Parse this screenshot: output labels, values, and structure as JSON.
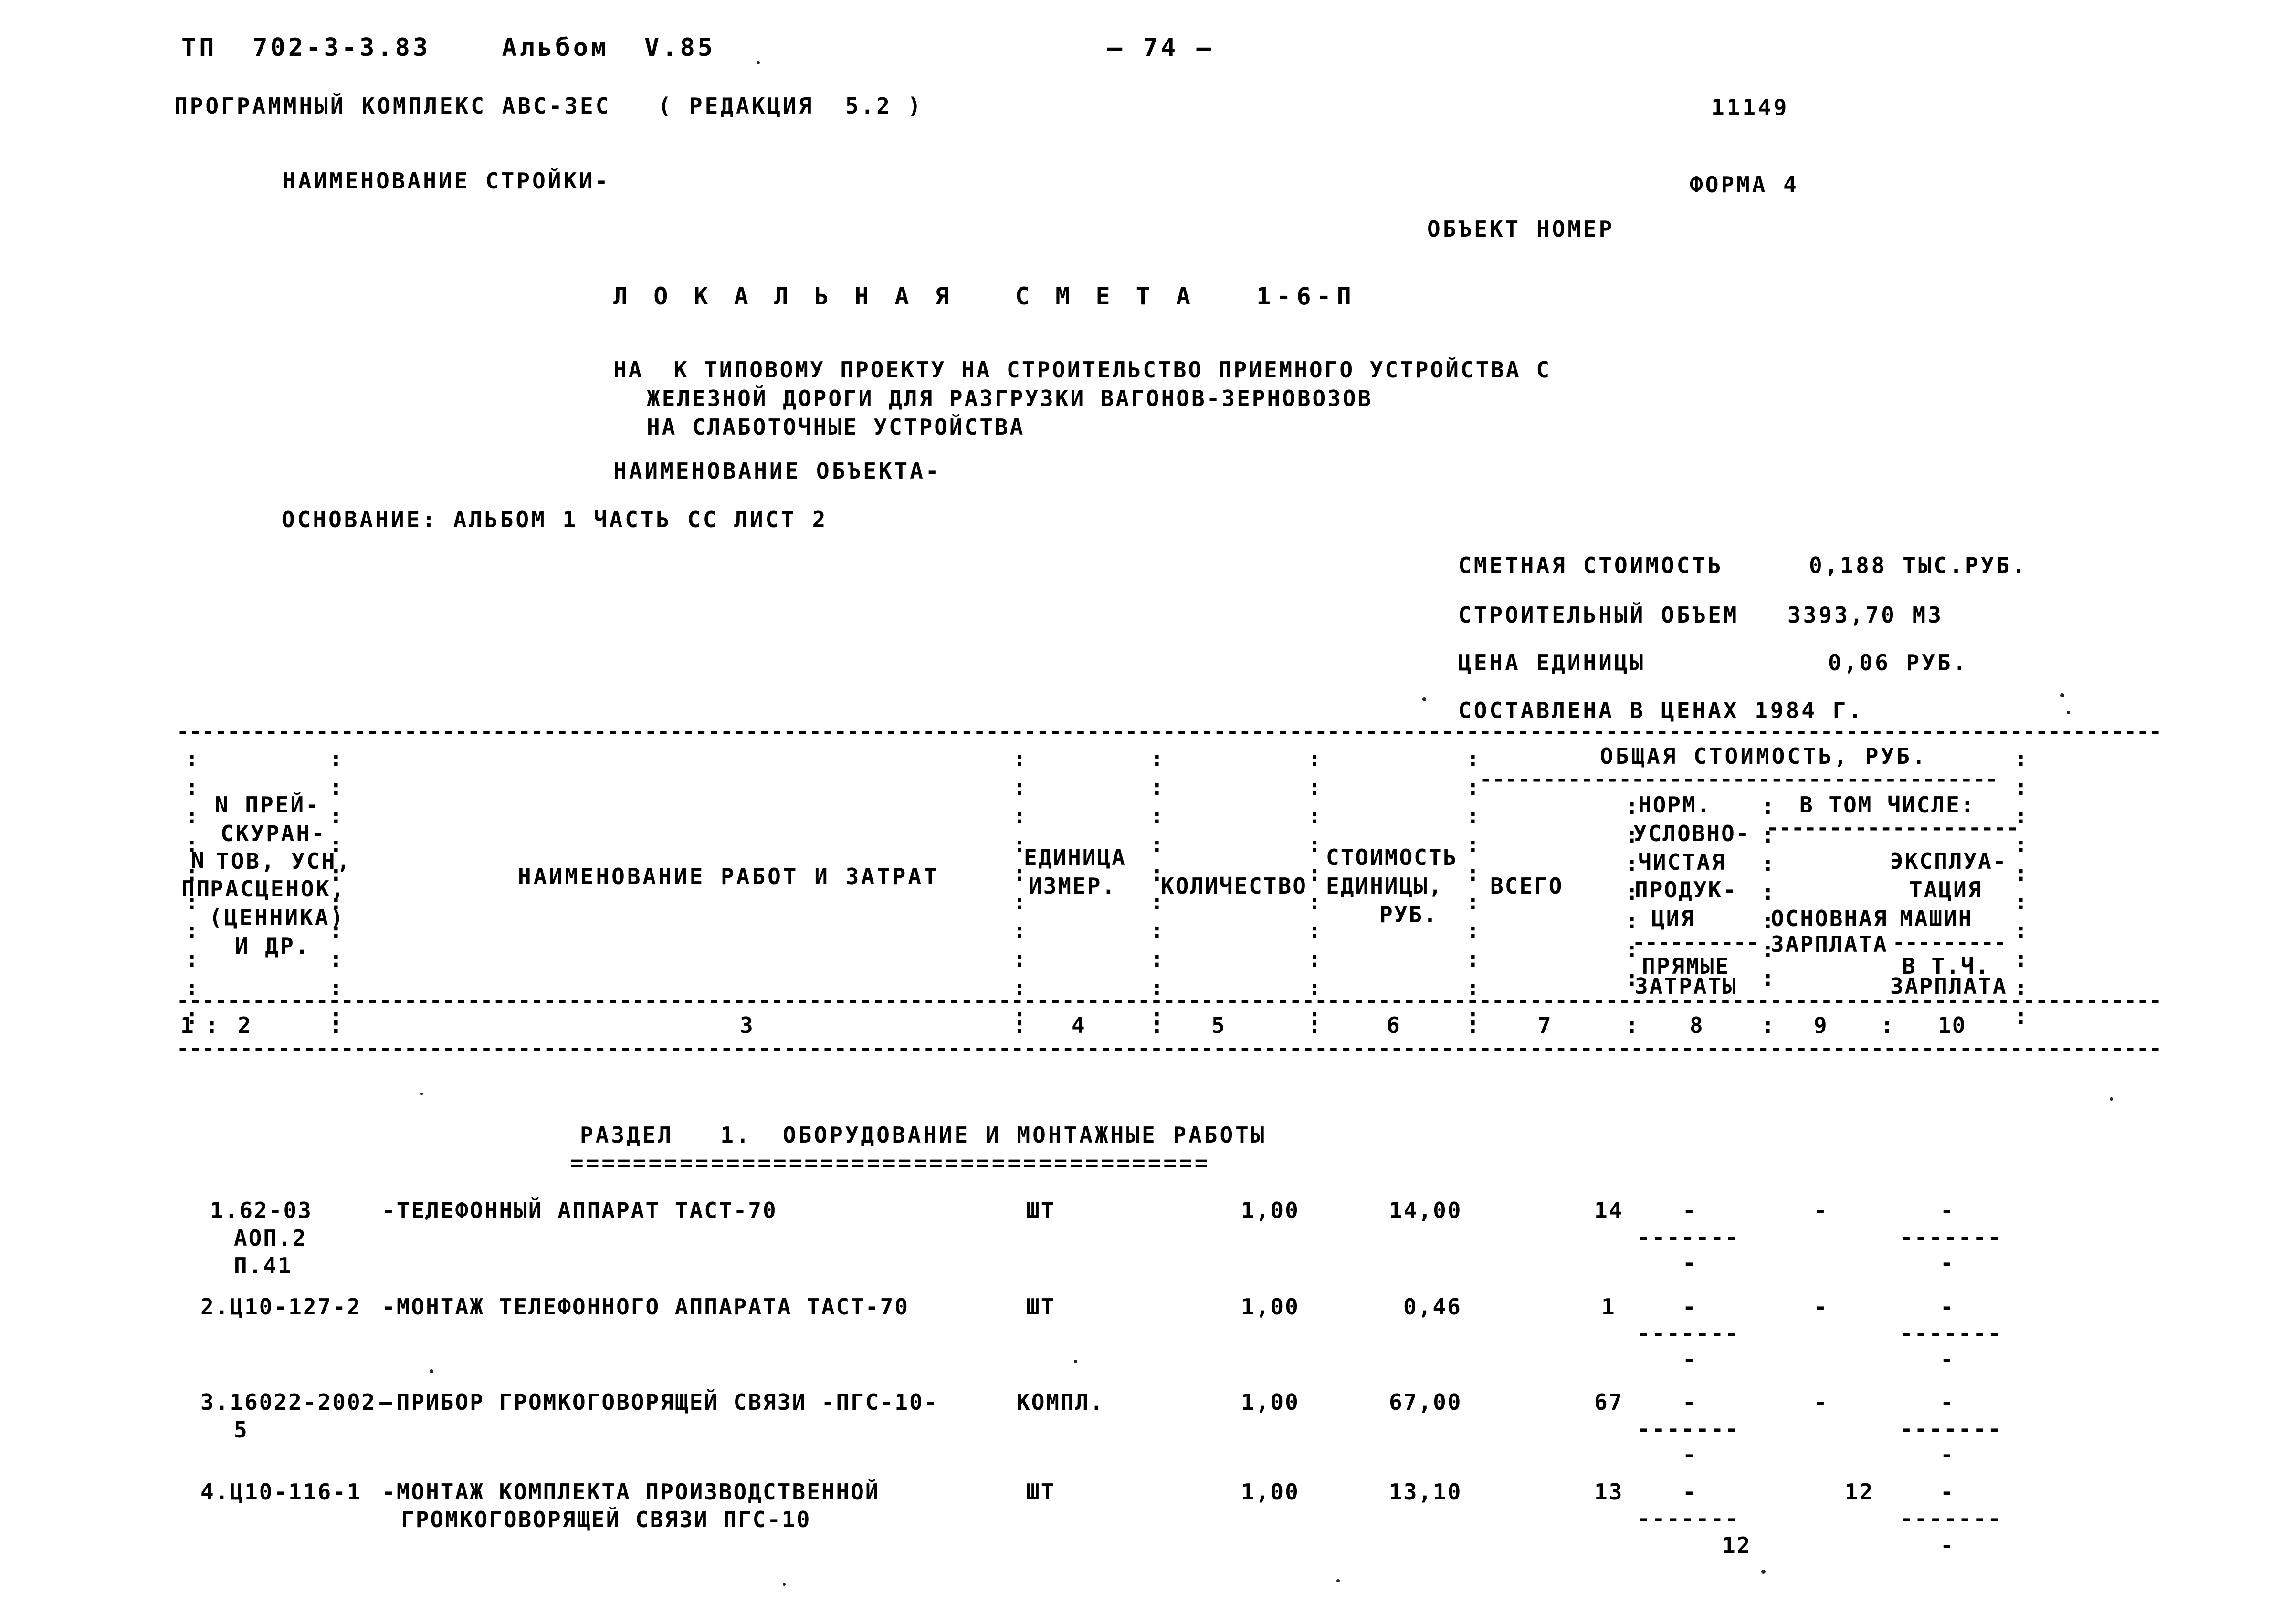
{
  "header": {
    "doc_code": "ТП  702-3-3.83    Альбом  V.85",
    "page_number": "— 74 —",
    "software_line": "ПРОГРАММНЫЙ КОМПЛЕКС АВС-3ЕС   ( РЕДАКЦИЯ  5.2 )",
    "doc_number": "11149",
    "construction_name_label": "НАИМЕНОВАНИЕ СТРОЙКИ-",
    "form_label": "ФОРМА 4",
    "object_number_label": "ОБЪЕКТ НОМЕР"
  },
  "title": {
    "main": "Л О К А Л Ь Н А Я   С М Е Т А   1-6-П",
    "desc_lines": [
      "НА  К ТИПОВОМУ ПРОЕКТУ НА СТРОИТЕЛЬСТВО ПРИЕМНОГО УСТРОЙСТВА С",
      "ЖЕЛЕЗНОЙ ДОРОГИ ДЛЯ РАЗГРУЗКИ ВАГОНОВ-ЗЕРНОВОЗОВ",
      "НА СЛАБОТОЧНЫЕ УСТРОЙСТВА"
    ],
    "object_name_label": "НАИМЕНОВАНИЕ ОБЪЕКТА-",
    "basis_line": "ОСНОВАНИЕ: АЛЬБОМ 1 ЧАСТЬ СС ЛИСТ 2"
  },
  "summary": [
    {
      "label": "СМЕТНАЯ СТОИМОСТЬ",
      "value": "0,188 ТЫС.РУБ."
    },
    {
      "label": "СТРОИТЕЛЬНЫЙ ОБЪЕМ",
      "value": "3393,70 М3"
    },
    {
      "label": "ЦЕНА ЕДИНИЦЫ",
      "value": "0,06 РУБ."
    },
    {
      "label": "СОСТАВЛЕНА В ЦЕНАХ 1984 Г.",
      "value": ""
    }
  ],
  "table": {
    "head": {
      "col1": [
        "N",
        "ПП"
      ],
      "col2": [
        "N ПРЕЙ-",
        "СКУРАН-",
        "ТОВ, УСН,",
        "РАСЦЕНОК,",
        "(ЦЕННИКА)",
        "И ДР."
      ],
      "col3": [
        "НАИМЕНОВАНИЕ РАБОТ И ЗАТРАТ"
      ],
      "col4": [
        "ЕДИНИЦА",
        "ИЗМЕР."
      ],
      "col5": [
        "КОЛИЧЕСТВО"
      ],
      "col6": [
        "СТОИМОСТЬ",
        "ЕДИНИЦЫ,",
        "РУБ."
      ],
      "group": "ОБЩАЯ СТОИМОСТЬ, РУБ.",
      "col7": [
        "ВСЕГО"
      ],
      "col8": [
        "НОРМ.",
        "УСЛОВНО-",
        "ЧИСТАЯ",
        "ПРОДУК-",
        "ЦИЯ",
        "ПРЯМЫЕ",
        "ЗАТРАТЫ"
      ],
      "col9_group": "В ТОМ ЧИСЛЕ:",
      "col9": [
        "ОСНОВНАЯ",
        "ЗАРПЛАТА"
      ],
      "col10": [
        "ЭКСПЛУА-",
        "ТАЦИЯ",
        "МАШИН",
        "В Т.Ч.",
        "ЗАРПЛАТА"
      ]
    },
    "column_numbers": [
      "1",
      "2",
      "3",
      "4",
      "5",
      "6",
      "7",
      "8",
      "9",
      "10"
    ],
    "section_title": "РАЗДЕЛ   1.  ОБОРУДОВАНИЕ И МОНТАЖНЫЕ РАБОТЫ",
    "section_rule": "=========================================",
    "rows": [
      {
        "no_code": "1.62-03",
        "code_extra": [
          "АОП.2",
          "П.41"
        ],
        "name": [
          "-ТЕЛЕФОННЫЙ АППАРАТ ТАСТ-70"
        ],
        "unit": "ШТ",
        "qty": "1,00",
        "unit_cost": "14,00",
        "total": "14",
        "c8": "-",
        "c8_dash": "-------",
        "c8_sub": "-",
        "c9": "-",
        "c10": "-",
        "c10_dash": "-------",
        "c10_sub": "-"
      },
      {
        "no_code": "2.Ц10-127-2",
        "code_extra": [],
        "name": [
          "-МОНТАЖ ТЕЛЕФОННОГО АППАРАТА ТАСТ-70"
        ],
        "unit": "ШТ",
        "qty": "1,00",
        "unit_cost": "0,46",
        "total": "1",
        "c8": "-",
        "c8_dash": "-------",
        "c8_sub": "-",
        "c9": "-",
        "c10": "-",
        "c10_dash": "-------",
        "c10_sub": "-"
      },
      {
        "no_code": "3.16022-2002-",
        "code_extra": [
          "5"
        ],
        "name": [
          "-ПРИБОР ГРОМКОГОВОРЯЩЕЙ СВЯЗИ -ПГС-10-"
        ],
        "unit": "КОМПЛ.",
        "qty": "1,00",
        "unit_cost": "67,00",
        "total": "67",
        "c8": "-",
        "c8_dash": "-------",
        "c8_sub": "-",
        "c9": "-",
        "c10": "-",
        "c10_dash": "-------",
        "c10_sub": "-"
      },
      {
        "no_code": "4.Ц10-116-1",
        "code_extra": [],
        "name": [
          "-МОНТАЖ КОМПЛЕКТА ПРОИЗВОДСТВЕННОЙ",
          "ГРОМКОГОВОРЯЩЕЙ СВЯЗИ ПГС-10"
        ],
        "unit": "ШТ",
        "qty": "1,00",
        "unit_cost": "13,10",
        "total": "13",
        "c8": "-",
        "c8_dash": "-------",
        "c8_sub": "12",
        "c9": "12",
        "c10": "-",
        "c10_dash": "-------",
        "c10_sub": "-"
      }
    ]
  },
  "style": {
    "ink": "#000000",
    "paper": "#ffffff"
  }
}
